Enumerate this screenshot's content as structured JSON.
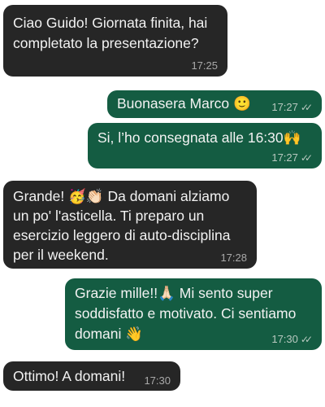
{
  "messages": [
    {
      "text": "Ciao Guido! Giornata finita, hai\ncompletato la presentazione?",
      "time": "17:25",
      "ticks": ""
    },
    {
      "text": "Buonasera Marco 🙂",
      "time": "17:27",
      "ticks": "✓✓"
    },
    {
      "text": "Si, l’ho consegnata alle 16:30🙌",
      "time": "17:27",
      "ticks": "✓✓"
    },
    {
      "text": "Grande! 🥳👏🏻 Da domani alziamo\nun po' l'asticella. Ti preparo un\nesercizio leggero di auto-disciplina\nper il weekend.",
      "time": "17:28",
      "ticks": ""
    },
    {
      "text": "Grazie mille!!🙏🏻 Mi sento super\nsoddisfatto e motivato. Ci sentiamo\ndomani 👋",
      "time": "17:30",
      "ticks": "✓✓"
    },
    {
      "text": "Ottimo! A domani!",
      "time": "17:30",
      "ticks": ""
    }
  ]
}
